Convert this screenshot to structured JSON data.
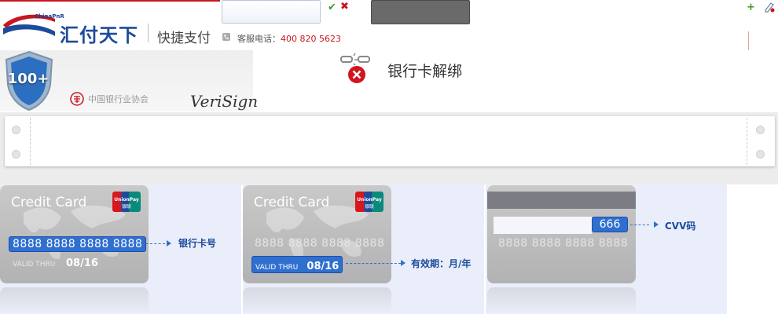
{
  "header": {
    "logo_small": "ChinaPnR",
    "brand": "汇付天下",
    "brand_sub": "快捷支付",
    "service_label": "客服电话：",
    "service_phone": "400 820 5623"
  },
  "security": {
    "shield_text": "100+",
    "association": "中国银行业协会",
    "verisign": "VeriSign"
  },
  "page": {
    "title": "银行卡解绑"
  },
  "cards": [
    {
      "title": "Credit Card",
      "brand": "UnionPay 银联",
      "number": "8888 8888 8888 8888",
      "valid_label": "VALID THRU",
      "valid_date": "08/16",
      "annotation": "银行卡号"
    },
    {
      "title": "Credit Card",
      "brand": "UnionPay 银联",
      "number": "8888 8888 8888 8888",
      "valid_label": "VALID THRU",
      "valid_date": "08/16",
      "annotation": "有效期：月/年"
    },
    {
      "cvv": "666",
      "number": "8888 8888 8888 8888",
      "annotation": "CVV码"
    }
  ],
  "colors": {
    "brand_red": "#c8161e",
    "brand_blue": "#1d4b9c",
    "highlight_blue": "#2f6fd0"
  },
  "icons": [
    "confirm-check-icon",
    "cancel-x-icon",
    "phone-icon",
    "add-plus-icon",
    "edit-icon",
    "unbind-icon",
    "shield-icon",
    "unionpay-logo"
  ]
}
